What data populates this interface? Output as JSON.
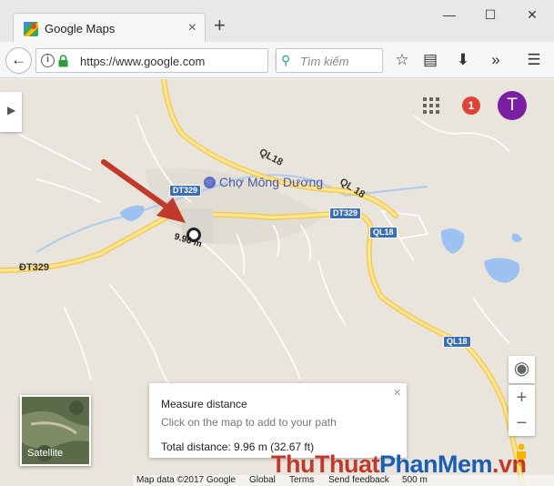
{
  "browser": {
    "tab_title": "Google Maps",
    "tab_close": "×",
    "new_tab": "+",
    "url": "https://www.google.com",
    "search_placeholder": "Tìm kiếm",
    "window": {
      "minimize": "—",
      "maximize": "☐",
      "close": "✕"
    }
  },
  "map": {
    "poi_label": "Chợ Mông Dương",
    "road_labels": [
      "QL18",
      "QL 18",
      "ĐT329"
    ],
    "shields": [
      "DT329",
      "DT329",
      "QL18",
      "QL18"
    ],
    "measure_point_label": "9.96 m",
    "notification_count": "1",
    "avatar_letter": "T",
    "satellite_label": "Satellite",
    "zoom_in": "+",
    "zoom_out": "−"
  },
  "measure_panel": {
    "title": "Measure distance",
    "hint": "Click on the map to add to your path",
    "total": "Total distance: 9.96 m (32.67 ft)",
    "close": "×"
  },
  "footer": {
    "map_data": "Map data ©2017 Google",
    "global": "Global",
    "terms": "Terms",
    "feedback": "Send feedback",
    "scale": "500 m"
  },
  "watermark": {
    "part1": "ThuThuat",
    "part2": "PhanMem",
    "part3": ".vn"
  },
  "colors": {
    "map_background": "#e9e5dc",
    "road": "#f6d66d",
    "water": "#8ab4f8",
    "arrow": "#c0392b",
    "avatar": "#7b1fa2",
    "badge": "#db4437"
  }
}
